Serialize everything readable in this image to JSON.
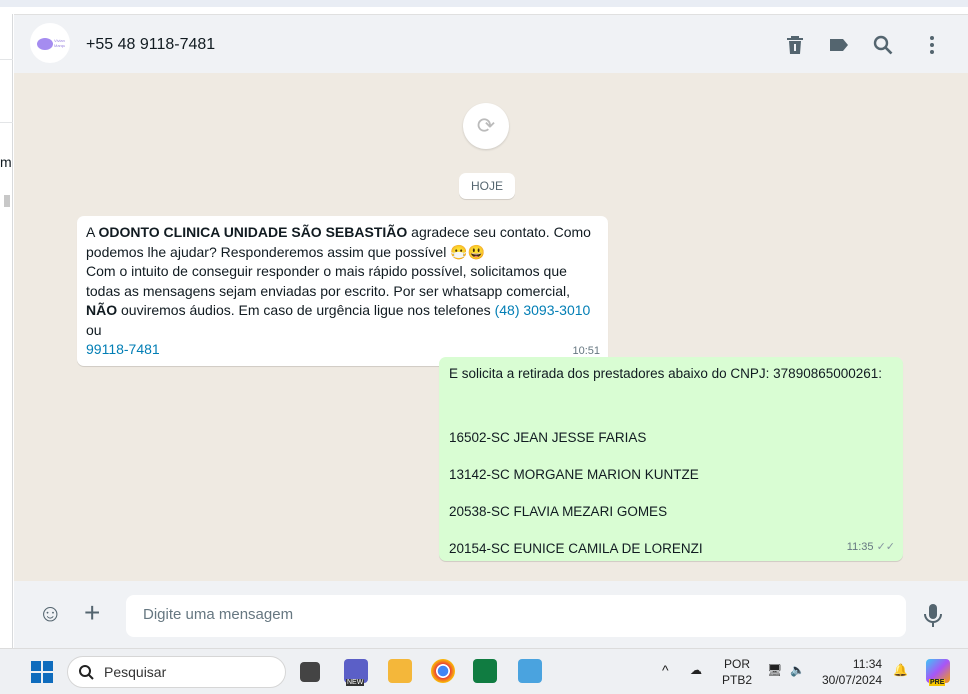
{
  "header": {
    "contact": "+55 48 9118-7481",
    "logo_text": "Odonto Clínica Viviane Marques"
  },
  "left_pane": {
    "partial_text": "m"
  },
  "chat": {
    "date_label": "HOJE",
    "incoming": {
      "p1": "A ",
      "bold1": "ODONTO CLINICA UNIDADE SÃO SEBASTIÃO",
      "p2": " agradece seu contato. Como podemos lhe ajudar? Responderemos assim que possível 😷😃",
      "p3": "Com o intuito de conseguir responder o mais rápido possível, solicitamos que todas as mensagens sejam enviadas por escrito. Por ser whatsapp comercial, ",
      "bold2": "NÃO",
      "p4": " ouviremos áudios. Em caso de urgência ligue nos telefones ",
      "phone1": "(48) 3093-3010",
      "p5": " ou ",
      "phone2": "99118-7481",
      "time": "10:51"
    },
    "outgoing": {
      "lines": [
        "E solicita a retirada dos prestadores abaixo do CNPJ: 37890865000261:",
        "16502-SC JEAN JESSE FARIAS",
        "13142-SC MORGANE MARION KUNTZE",
        "20538-SC FLAVIA MEZARI GOMES",
        "20154-SC EUNICE CAMILA DE LORENZI"
      ],
      "time": "11:35"
    }
  },
  "composer": {
    "placeholder": "Digite uma mensagem"
  },
  "taskbar": {
    "search": "Pesquisar",
    "lang1": "POR",
    "lang2": "PTB2",
    "time": "11:34",
    "date": "30/07/2024",
    "copilot_badge": "PRE",
    "teams_badge": "NEW"
  }
}
